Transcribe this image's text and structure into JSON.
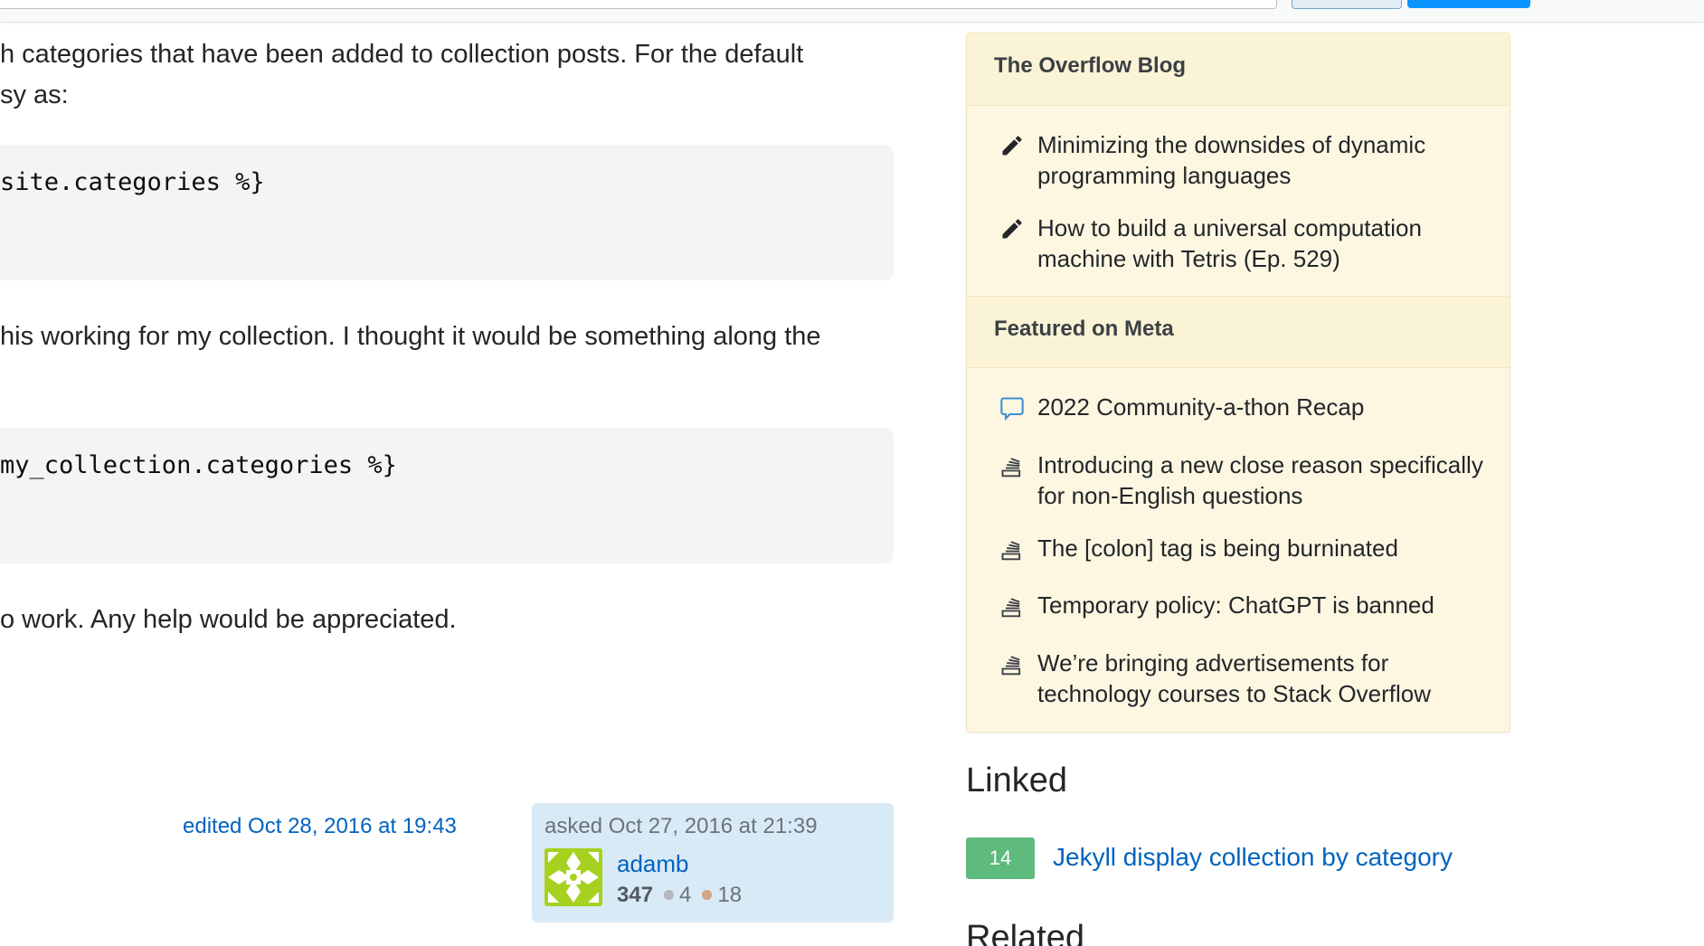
{
  "question": {
    "paragraphs": [
      "h categories that have been added to collection posts. For the default",
      "sy as:",
      "his working for my collection. I thought it would be something along the",
      "o work. Any help would be appreciated."
    ],
    "code_blocks": [
      "site.categories %}",
      "my_collection.categories %}"
    ]
  },
  "signature": {
    "edited_text": "edited Oct 28, 2016 at 19:43",
    "asked_text": "asked Oct 27, 2016 at 21:39",
    "user_name": "adamb",
    "reputation": "347",
    "silver_badges": "4",
    "bronze_badges": "18"
  },
  "sidebar": {
    "blog": {
      "title": "The Overflow Blog",
      "items": [
        {
          "icon": "pencil-icon",
          "text": "Minimizing the downsides of dynamic programming languages"
        },
        {
          "icon": "pencil-icon",
          "text": "How to build a universal computation machine with Tetris (Ep. 529)"
        }
      ]
    },
    "meta": {
      "title": "Featured on Meta",
      "items": [
        {
          "icon": "speech-bubble-icon",
          "text": "2022 Community-a-thon Recap"
        },
        {
          "icon": "stack-exchange-icon",
          "text": "Introducing a new close reason specifically for non-English questions"
        },
        {
          "icon": "stack-exchange-icon",
          "text": "The [colon] tag is being burninated"
        },
        {
          "icon": "stack-exchange-icon",
          "text": "Temporary policy: ChatGPT is banned"
        },
        {
          "icon": "stack-exchange-icon",
          "text": "We’re bringing advertisements for technology courses to Stack Overflow"
        }
      ]
    },
    "linked": {
      "title": "Linked",
      "items": [
        {
          "score": "14",
          "title": "Jekyll display collection by category"
        }
      ]
    },
    "related": {
      "title": "Related"
    }
  },
  "colors": {
    "link": "#0063bf",
    "widget_bg": "#fdf7e2",
    "widget_header_bg": "#fbf3d5",
    "accepted_badge": "#5eba7d",
    "owner_card_bg": "#d9eaf7",
    "code_bg": "#f4f4f4"
  }
}
